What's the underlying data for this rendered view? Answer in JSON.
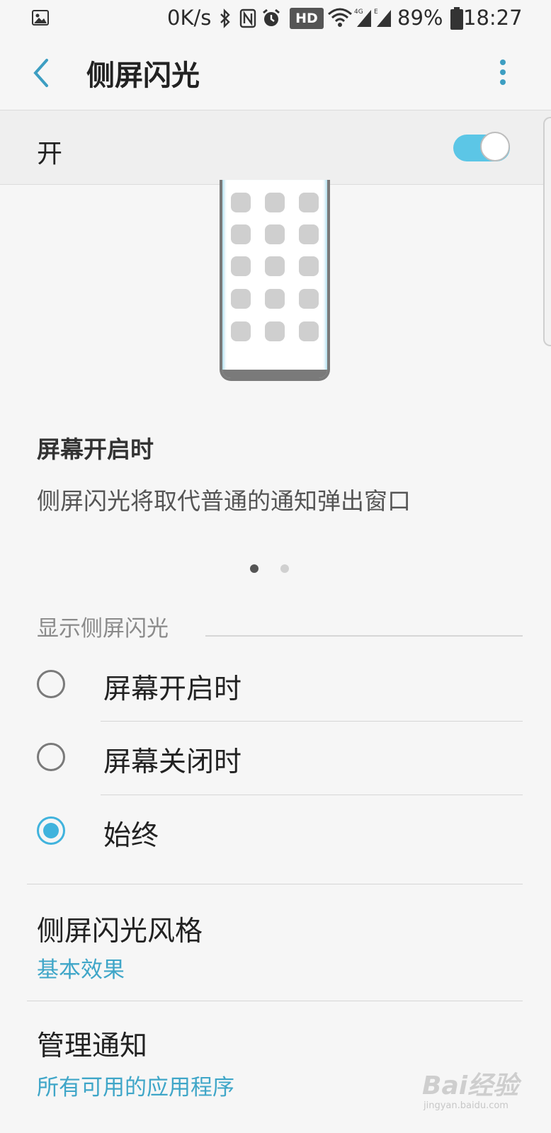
{
  "status_bar": {
    "speed": "0K/s",
    "hd_badge": "HD",
    "battery": "89%",
    "time": "18:27",
    "icons": [
      "image-icon",
      "bluetooth-icon",
      "nfc-icon",
      "alarm-icon",
      "wifi-icon",
      "signal-4g-icon",
      "signal-e-icon",
      "battery-icon"
    ]
  },
  "app_bar": {
    "title": "侧屏闪光",
    "back_icon": "back-arrow-icon",
    "more_icon": "more-vert-icon"
  },
  "master_switch": {
    "label": "开",
    "state": "on",
    "accent_color": "#5cc6e6"
  },
  "carousel": {
    "title": "屏幕开启时",
    "description": "侧屏闪光将取代普通的通知弹出窗口",
    "page_count": 2,
    "active_page": 1
  },
  "display_section": {
    "header": "显示侧屏闪光",
    "options": [
      {
        "label": "屏幕开启时",
        "selected": false
      },
      {
        "label": "屏幕关闭时",
        "selected": false
      },
      {
        "label": "始终",
        "selected": true
      }
    ]
  },
  "style_item": {
    "title": "侧屏闪光风格",
    "value": "基本效果"
  },
  "notify_item": {
    "title": "管理通知",
    "value": "所有可用的应用程序"
  },
  "watermark": {
    "brand": "Bai经验",
    "url": "jingyan.baidu.com"
  }
}
